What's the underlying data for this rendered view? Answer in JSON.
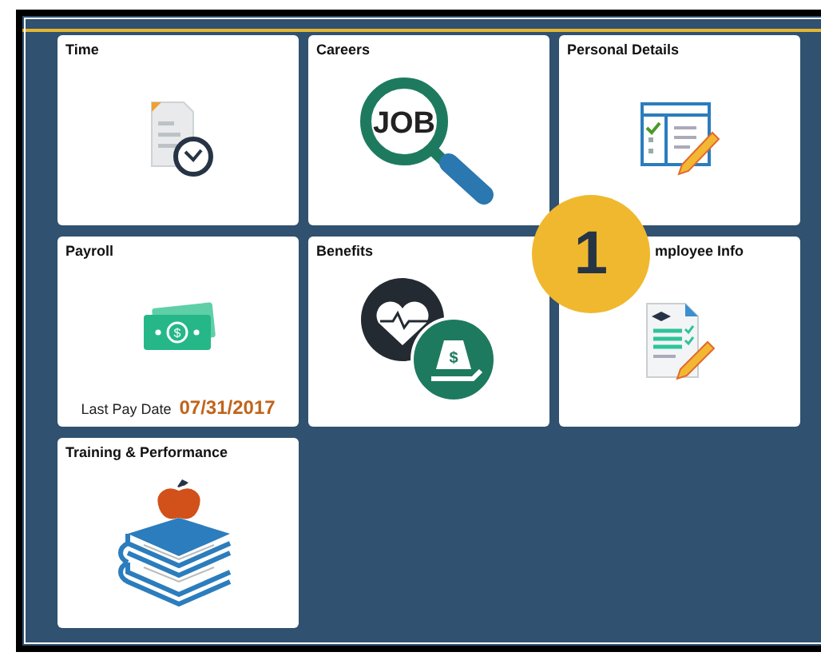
{
  "tiles": [
    {
      "title": "Time",
      "kind": "time"
    },
    {
      "title": "Careers",
      "kind": "careers",
      "icon_text": "JOB"
    },
    {
      "title": "Personal Details",
      "kind": "personal"
    },
    {
      "title": "Payroll",
      "kind": "payroll",
      "icon_text": "$",
      "footer": {
        "label": "Last Pay Date",
        "value": "07/31/2017"
      }
    },
    {
      "title": "Benefits",
      "kind": "benefits",
      "icon_text": "$"
    },
    {
      "title": "mployee Info",
      "kind": "employee",
      "badge": "1"
    },
    {
      "title": "Training & Performance",
      "kind": "training"
    }
  ]
}
